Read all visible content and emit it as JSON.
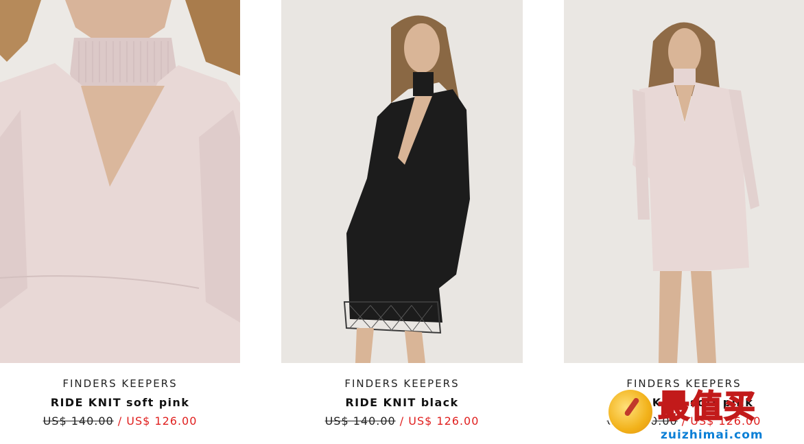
{
  "products": [
    {
      "image_label": "model wearing soft pink knit choker dress, close-up",
      "brand": "FINDERS KEEPERS",
      "name": "RIDE KNIT soft pink",
      "old_price": "US$ 140.00",
      "separator": " / ",
      "sale_price": "US$ 126.00"
    },
    {
      "image_label": "model wearing black knit choker dress with lace hem",
      "brand": "FINDERS KEEPERS",
      "name": "RIDE KNIT black",
      "old_price": "US$ 140.00",
      "separator": " / ",
      "sale_price": "US$ 126.00"
    },
    {
      "image_label": "model wearing soft pink knit choker dress, full length",
      "brand": "FINDERS KEEPERS",
      "name": "RIDE KNIT soft pink",
      "old_price": "US$ 140.00",
      "separator": " / ",
      "sale_price": "US$ 126.00"
    }
  ],
  "watermark": {
    "title": "最值买",
    "domain": "zuizhimai.com"
  },
  "colors": {
    "sale": "#e0201f",
    "text": "#222222",
    "photo_bg": "#e9e6e2",
    "pink_dress": "#e8d8d6",
    "black_dress": "#1c1c1c"
  }
}
